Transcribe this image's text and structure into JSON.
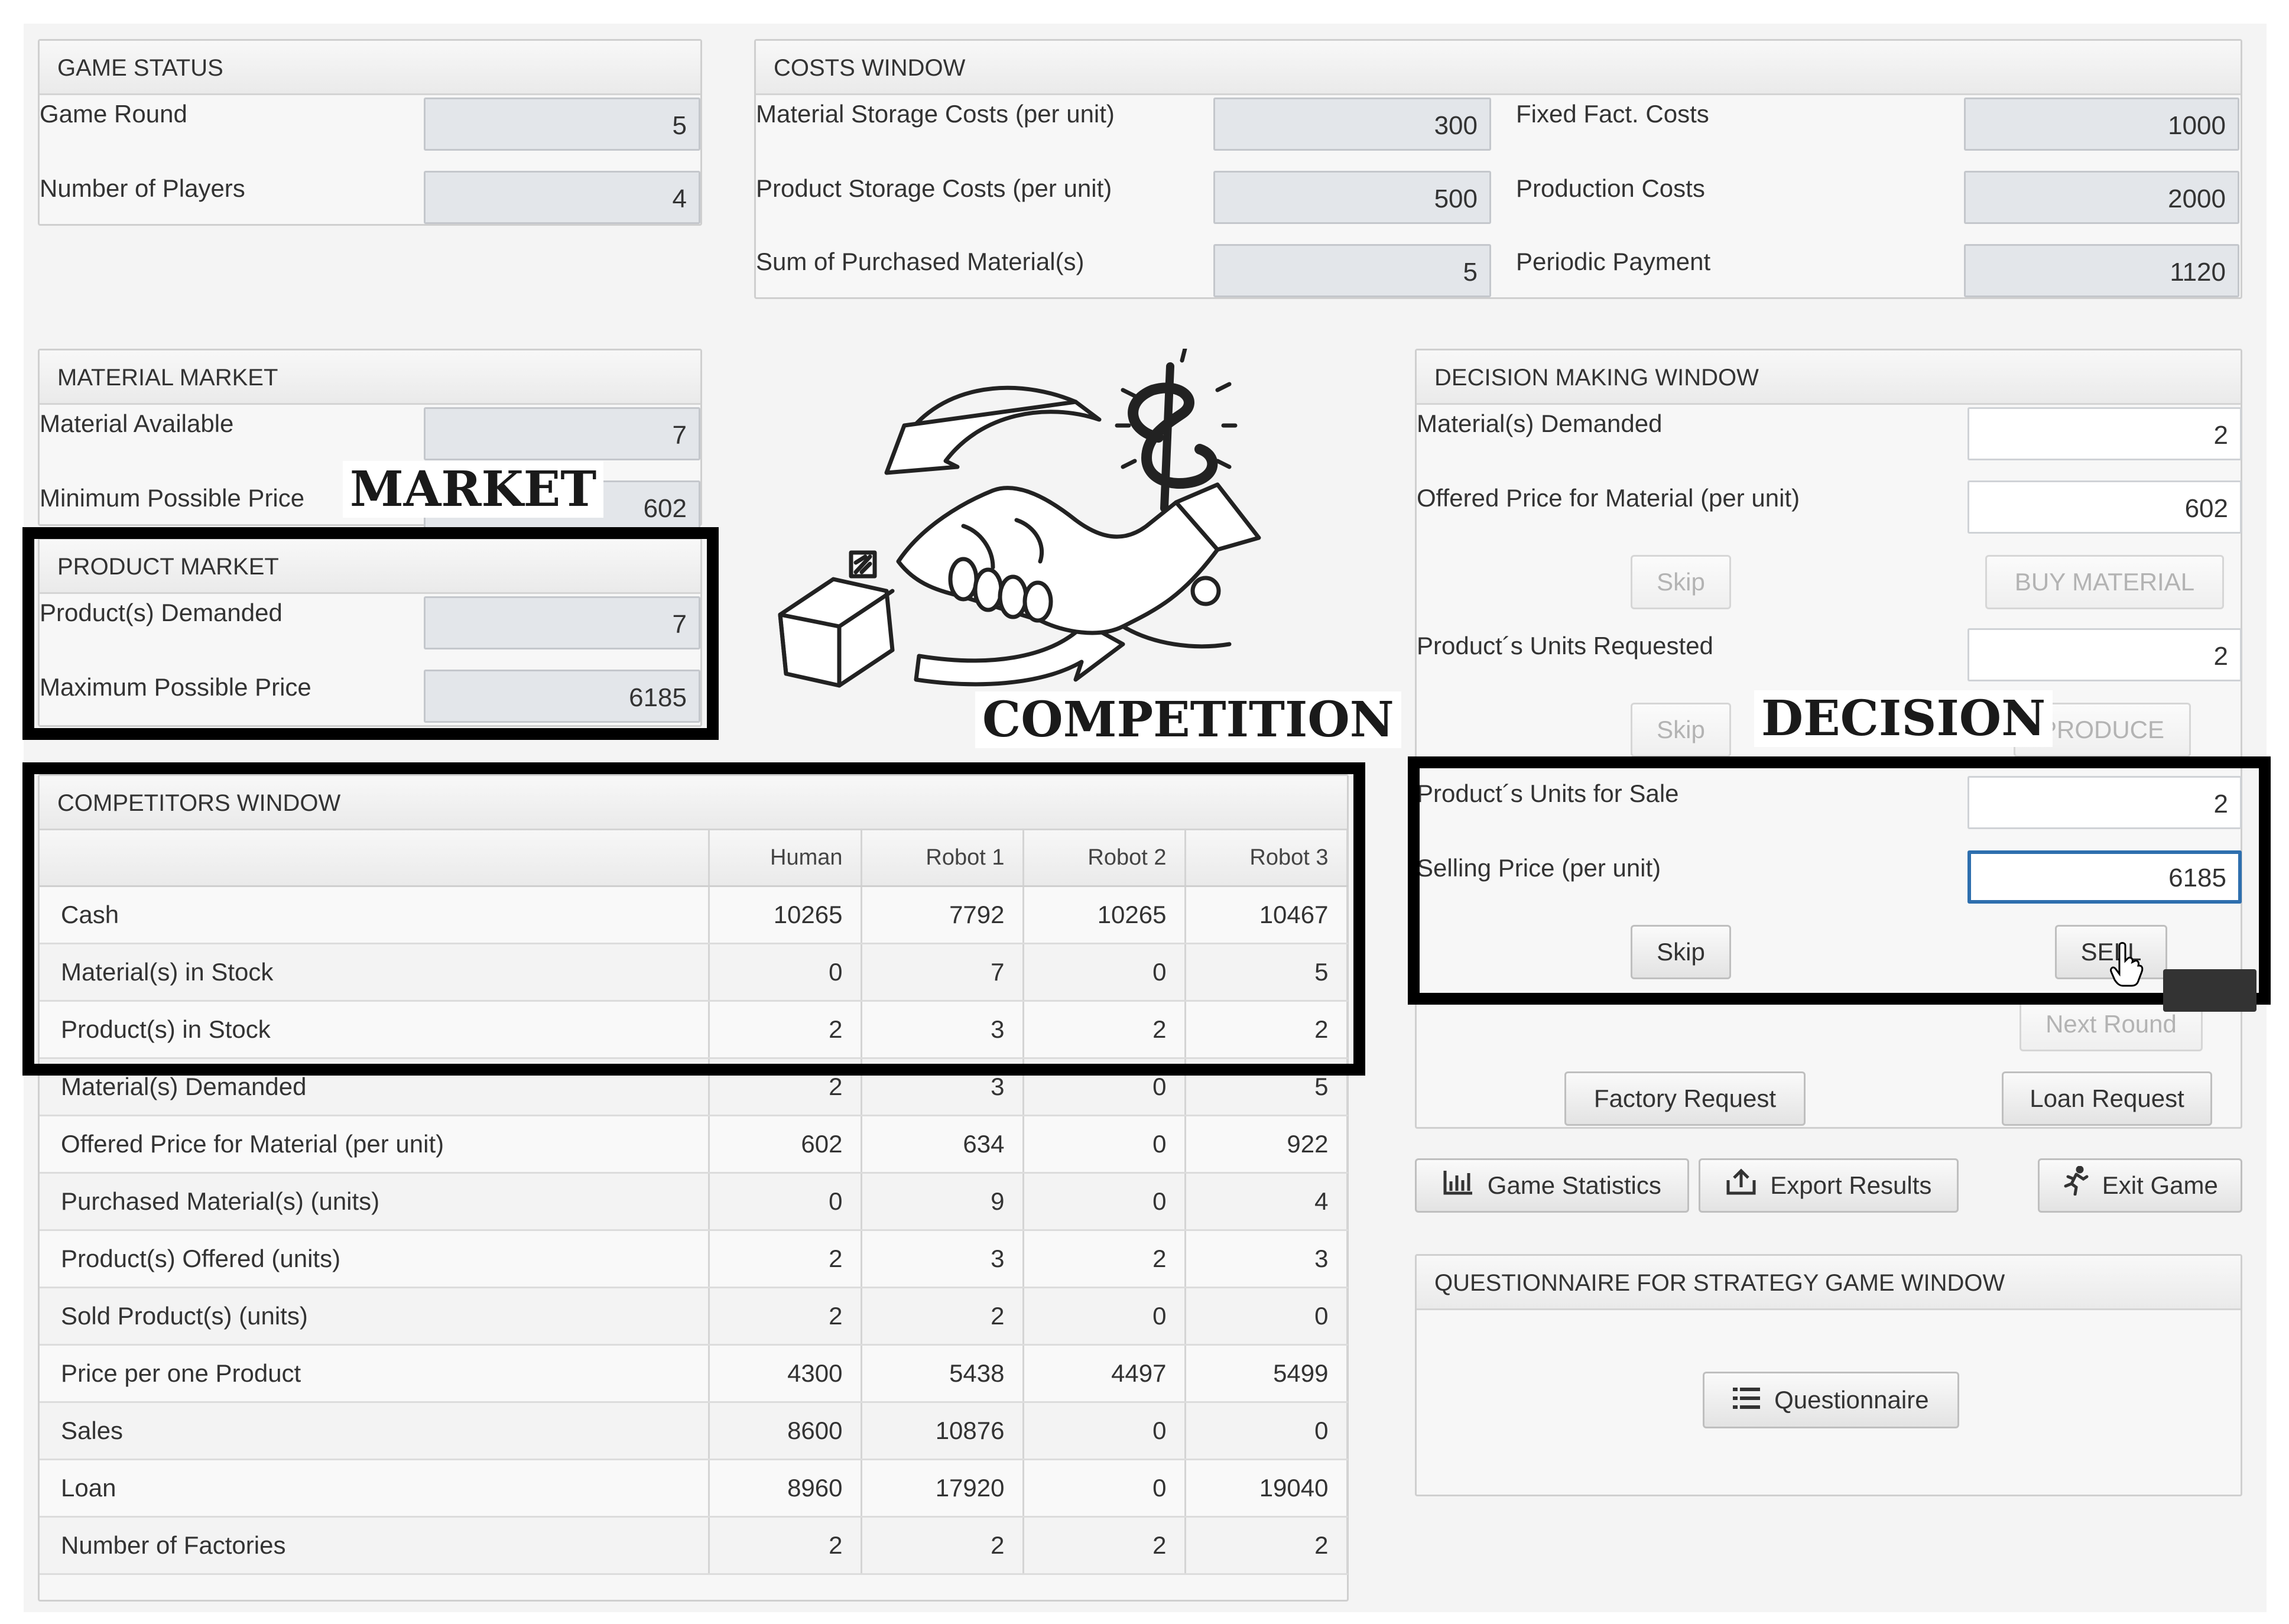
{
  "game_status": {
    "title": "GAME STATUS",
    "round_label": "Game Round",
    "round_value": "5",
    "players_label": "Number of Players",
    "players_value": "4"
  },
  "costs": {
    "title": "COSTS WINDOW",
    "material_storage_label": "Material Storage Costs (per unit)",
    "material_storage_value": "300",
    "product_storage_label": "Product Storage Costs (per unit)",
    "product_storage_value": "500",
    "purchased_label": "Sum of Purchased Material(s)",
    "purchased_value": "5",
    "fixed_label": "Fixed Fact. Costs",
    "fixed_value": "1000",
    "production_label": "Production Costs",
    "production_value": "2000",
    "periodic_label": "Periodic Payment",
    "periodic_value": "1120"
  },
  "material_market": {
    "title": "MATERIAL MARKET",
    "available_label": "Material Available",
    "available_value": "7",
    "min_price_label": "Minimum Possible Price",
    "min_price_value": "602"
  },
  "product_market": {
    "title": "PRODUCT MARKET",
    "demanded_label": "Product(s) Demanded",
    "demanded_value": "7",
    "max_price_label": "Maximum Possible Price",
    "max_price_value": "6185"
  },
  "overlay_words": {
    "market": "MARKET",
    "competition": "COMPETITION",
    "decision": "DECISION"
  },
  "decision": {
    "title": "DECISION MAKING WINDOW",
    "materials_demanded_label": "Material(s) Demanded",
    "materials_demanded_value": "2",
    "offered_price_label": "Offered Price for Material (per unit)",
    "offered_price_value": "602",
    "skip_label": "Skip",
    "buy_label": "BUY MATERIAL",
    "units_requested_label": "Product´s Units Requested",
    "units_requested_value": "2",
    "produce_label": "PRODUCE",
    "units_sale_label": "Product´s Units for Sale",
    "units_sale_value": "2",
    "selling_price_label": "Selling Price (per unit)",
    "selling_price_value": "6185",
    "sell_label": "SELL",
    "next_round_label": "Next Round",
    "factory_request_label": "Factory Request",
    "loan_request_label": "Loan Request"
  },
  "actions": {
    "statistics_label": "Game Statistics",
    "export_label": "Export Results",
    "exit_label": "Exit Game"
  },
  "questionnaire": {
    "title": "QUESTIONNAIRE FOR STRATEGY GAME WINDOW",
    "button_label": "Questionnaire"
  },
  "competitors": {
    "title": "COMPETITORS WINDOW",
    "columns": [
      "",
      "Human",
      "Robot 1",
      "Robot 2",
      "Robot 3"
    ],
    "rows": [
      [
        "Cash",
        "10265",
        "7792",
        "10265",
        "10467"
      ],
      [
        "Material(s) in Stock",
        "0",
        "7",
        "0",
        "5"
      ],
      [
        "Product(s) in Stock",
        "2",
        "3",
        "2",
        "2"
      ],
      [
        "Material(s) Demanded",
        "2",
        "3",
        "0",
        "5"
      ],
      [
        "Offered Price for Material (per unit)",
        "602",
        "634",
        "0",
        "922"
      ],
      [
        "Purchased Material(s) (units)",
        "0",
        "9",
        "0",
        "4"
      ],
      [
        "Product(s) Offered (units)",
        "2",
        "3",
        "2",
        "3"
      ],
      [
        "Sold Product(s) (units)",
        "2",
        "2",
        "0",
        "0"
      ],
      [
        "Price per one Product",
        "4300",
        "5438",
        "4497",
        "5499"
      ],
      [
        "Sales",
        "8600",
        "10876",
        "0",
        "0"
      ],
      [
        "Loan",
        "8960",
        "17920",
        "0",
        "19040"
      ],
      [
        "Number of Factories",
        "2",
        "2",
        "2",
        "2"
      ]
    ]
  }
}
